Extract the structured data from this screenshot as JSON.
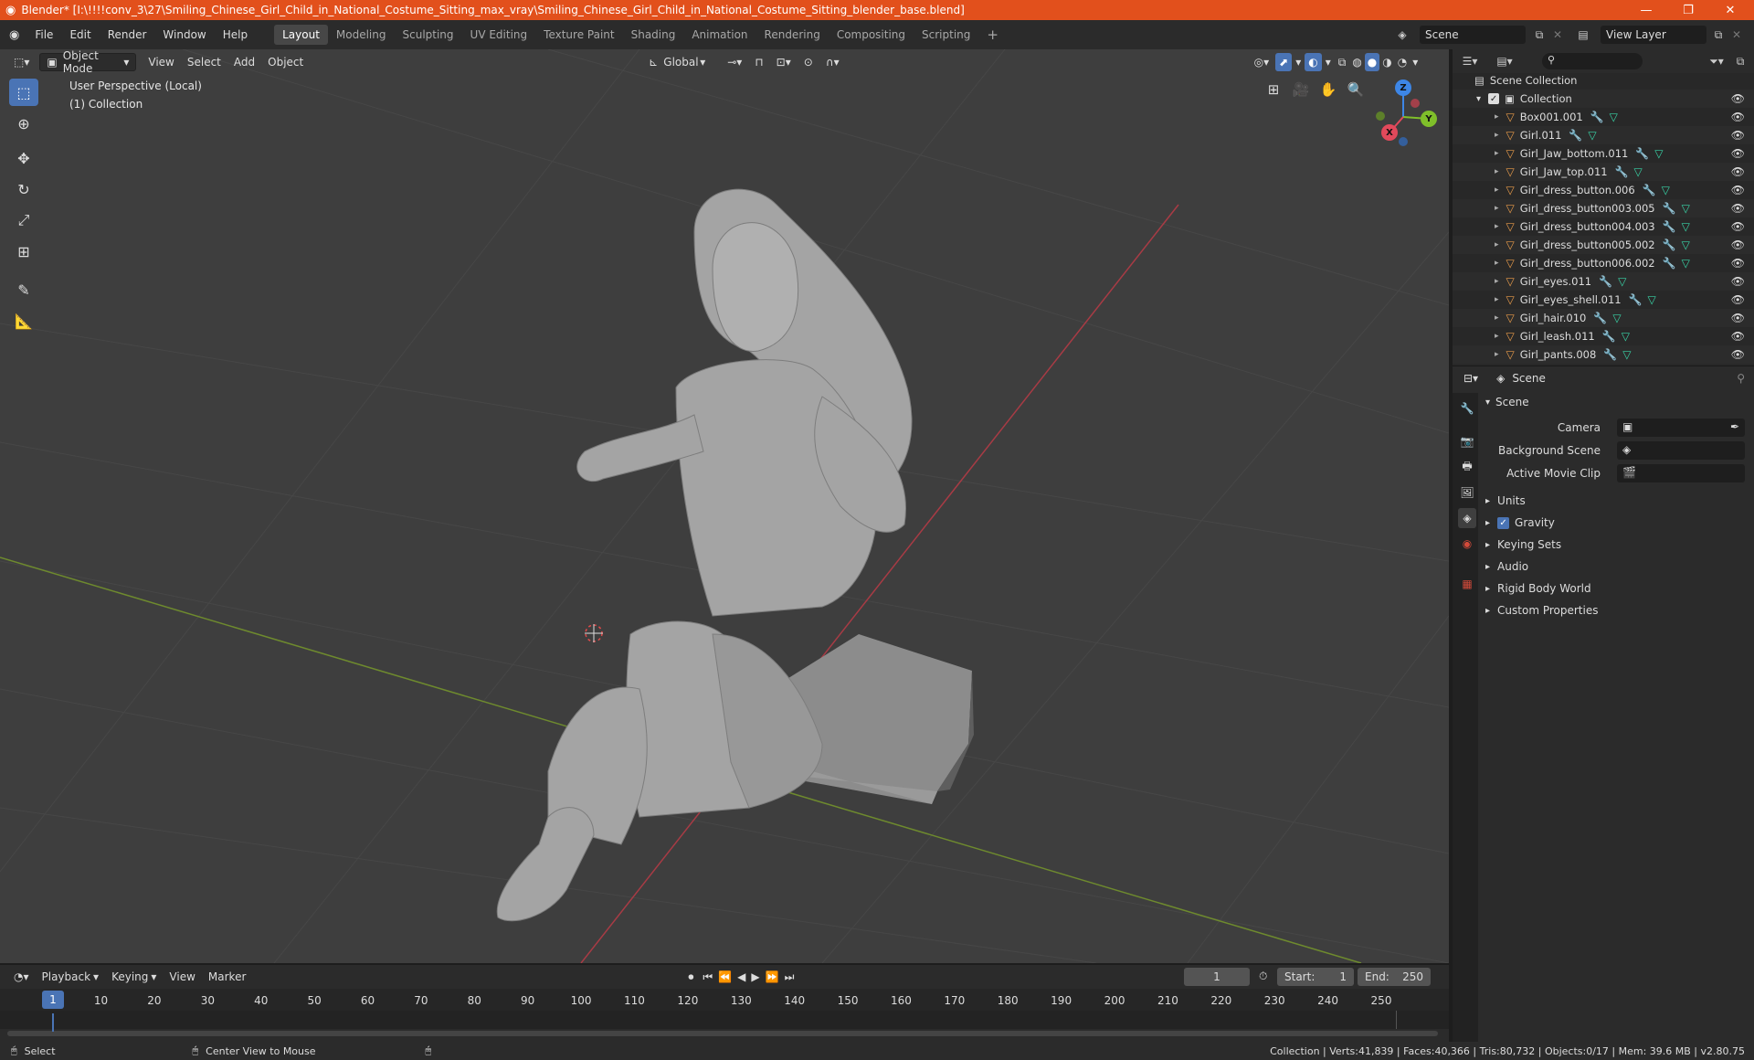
{
  "window": {
    "title": "Blender* [I:\\!!!!conv_3\\27\\Smiling_Chinese_Girl_Child_in_National_Costume_Sitting_max_vray\\Smiling_Chinese_Girl_Child_in_National_Costume_Sitting_blender_base.blend]",
    "minimize": "—",
    "restore": "❐",
    "close": "✕"
  },
  "menus": [
    "File",
    "Edit",
    "Render",
    "Window",
    "Help"
  ],
  "workspaces": [
    "Layout",
    "Modeling",
    "Sculpting",
    "UV Editing",
    "Texture Paint",
    "Shading",
    "Animation",
    "Rendering",
    "Compositing",
    "Scripting"
  ],
  "workspace_add": "+",
  "scene_name": "Scene",
  "view_layer": "View Layer",
  "viewport_header": {
    "mode": "Object Mode",
    "view": "View",
    "select": "Select",
    "add": "Add",
    "object": "Object",
    "transform": "Global"
  },
  "viewport_info": {
    "perspective": "User Perspective (Local)",
    "collection": "(1) Collection"
  },
  "gizmo": {
    "x": "X",
    "y": "Y",
    "z": "Z"
  },
  "outliner": {
    "root": "Scene Collection",
    "collection": "Collection",
    "objects": [
      "Box001.001",
      "Girl.011",
      "Girl_Jaw_bottom.011",
      "Girl_Jaw_top.011",
      "Girl_dress_button.006",
      "Girl_dress_button003.005",
      "Girl_dress_button004.003",
      "Girl_dress_button005.002",
      "Girl_dress_button006.002",
      "Girl_eyes.011",
      "Girl_eyes_shell.011",
      "Girl_hair.010",
      "Girl_leash.011",
      "Girl_pants.008"
    ]
  },
  "properties": {
    "header": "Scene",
    "panel": "Scene",
    "camera_label": "Camera",
    "background_scene_label": "Background Scene",
    "active_movie_clip_label": "Active Movie Clip",
    "sections": [
      "Units",
      "Gravity",
      "Keying Sets",
      "Audio",
      "Rigid Body World",
      "Custom Properties"
    ]
  },
  "timeline": {
    "playback": "Playback",
    "keying": "Keying",
    "view": "View",
    "marker": "Marker",
    "current_frame": "1",
    "start_label": "Start:",
    "start": "1",
    "end_label": "End:",
    "end": "250",
    "ticks": [
      "1",
      "10",
      "20",
      "30",
      "40",
      "50",
      "60",
      "70",
      "80",
      "90",
      "100",
      "110",
      "120",
      "130",
      "140",
      "150",
      "160",
      "170",
      "180",
      "190",
      "200",
      "210",
      "220",
      "230",
      "240",
      "250"
    ]
  },
  "statusbar": {
    "select": "Select",
    "center_view": "Center View to Mouse",
    "stats": "Collection | Verts:41,839 | Faces:40,366 | Tris:80,732 | Objects:0/17 | Mem: 39.6 MB | v2.80.75"
  },
  "colors": {
    "titlebar": "#e2501c",
    "accent": "#4a74b5",
    "viewport_bg": "#3e3e3e",
    "x_axis": "#e2495b",
    "y_axis": "#7fbf2a",
    "z_axis": "#3d86e6"
  }
}
